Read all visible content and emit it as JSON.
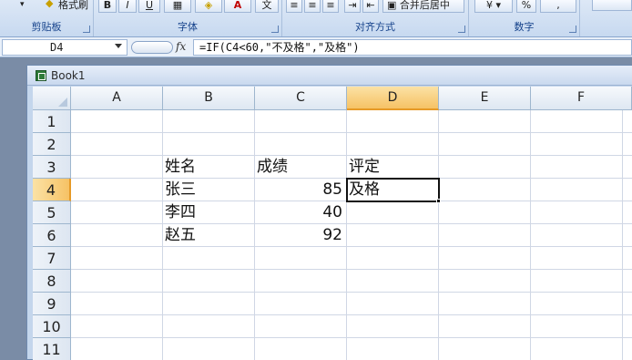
{
  "ribbon": {
    "groups": [
      {
        "label": "剪贴板"
      },
      {
        "label": "字体"
      },
      {
        "label": "对齐方式"
      },
      {
        "label": "数字"
      }
    ],
    "format_painter": "格式刷",
    "bold": "B",
    "italic": "I",
    "underline": "U",
    "font_color": "A",
    "wen": "文",
    "merge_center": "合并后居中"
  },
  "formula_bar": {
    "name_box": "D4",
    "fx": "fx",
    "formula": "=IF(C4<60,\"不及格\",\"及格\")"
  },
  "workbook": {
    "title": "Book1",
    "columns": [
      "A",
      "B",
      "C",
      "D",
      "E",
      "F"
    ],
    "rows": [
      "1",
      "2",
      "3",
      "4",
      "5",
      "6",
      "7",
      "8",
      "9",
      "10",
      "11"
    ],
    "active_cell": "D4",
    "cells": {
      "B3": "姓名",
      "C3": "成绩",
      "D3": "评定",
      "B4": "张三",
      "C4": "85",
      "D4": "及格",
      "B5": "李四",
      "C5": "40",
      "B6": "赵五",
      "C6": "92"
    }
  }
}
